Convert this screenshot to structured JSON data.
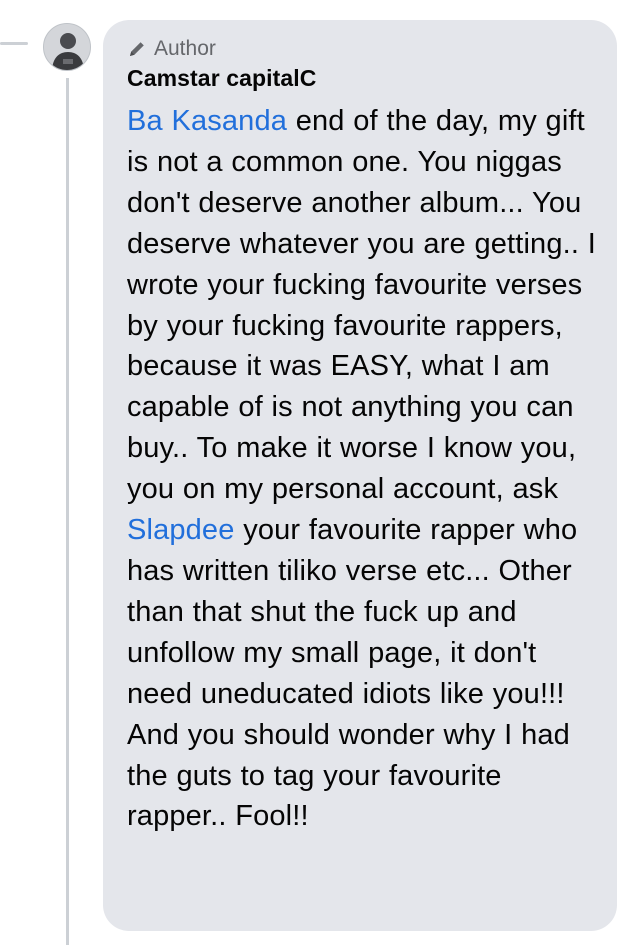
{
  "comment": {
    "badge_label": "Author",
    "badge_icon": "pencil-icon",
    "author_name": "Camstar capitalC",
    "mention_color": "#216fdb",
    "mention_1": "Ba Kasanda",
    "text_1": " end of the day,  my gift is not a common one.  You niggas don't deserve another album... You deserve whatever you are getting..  I wrote your fucking favourite verses by your fucking favourite rappers, because it was EASY,  what I am capable of is not anything you can buy.. To make it worse I know you,  you on my personal account,  ask ",
    "mention_2": "Slapdee",
    "text_2": " your favourite rapper who has written tiliko verse etc...  Other than that shut the fuck up and unfollow my small page,  it don't need uneducated idiots like you!!!  And you should wonder why I had the guts to tag your favourite rapper.. Fool!!"
  }
}
